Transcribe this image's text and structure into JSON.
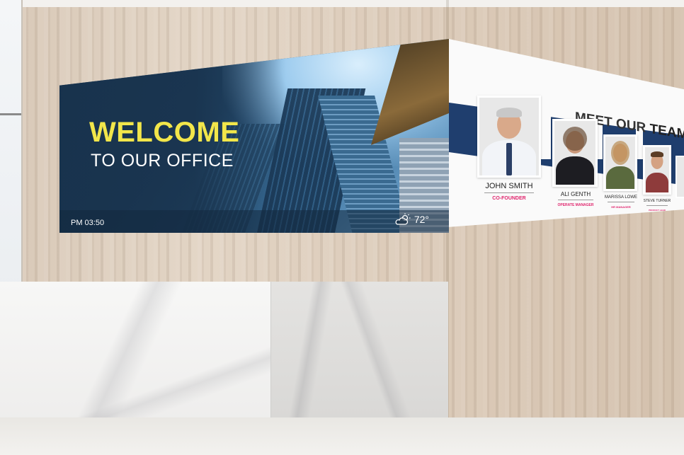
{
  "display_left": {
    "headline": "WELCOME",
    "subline": "TO OUR OFFICE",
    "clock": "PM 03:50",
    "temperature": "72°",
    "weather_icon": "partly-sunny-icon",
    "colors": {
      "headline": "#f2e64a",
      "panel": "#1e3c5a"
    }
  },
  "display_right": {
    "heading_light": "MEET OUR",
    "heading_bold": "TEAM",
    "members": [
      {
        "name": "JOHN SMITH",
        "role": "CO-FOUNDER"
      },
      {
        "name": "ALI GENTH",
        "role": "OPERATE MANAGER"
      },
      {
        "name": "MARISSA LOWE",
        "role": "HR MANAGER"
      },
      {
        "name": "STEVE TURNER",
        "role": "PRODUCT LEAD"
      }
    ],
    "colors": {
      "stripe": "#1f3e6e",
      "role": "#e0266e"
    }
  }
}
